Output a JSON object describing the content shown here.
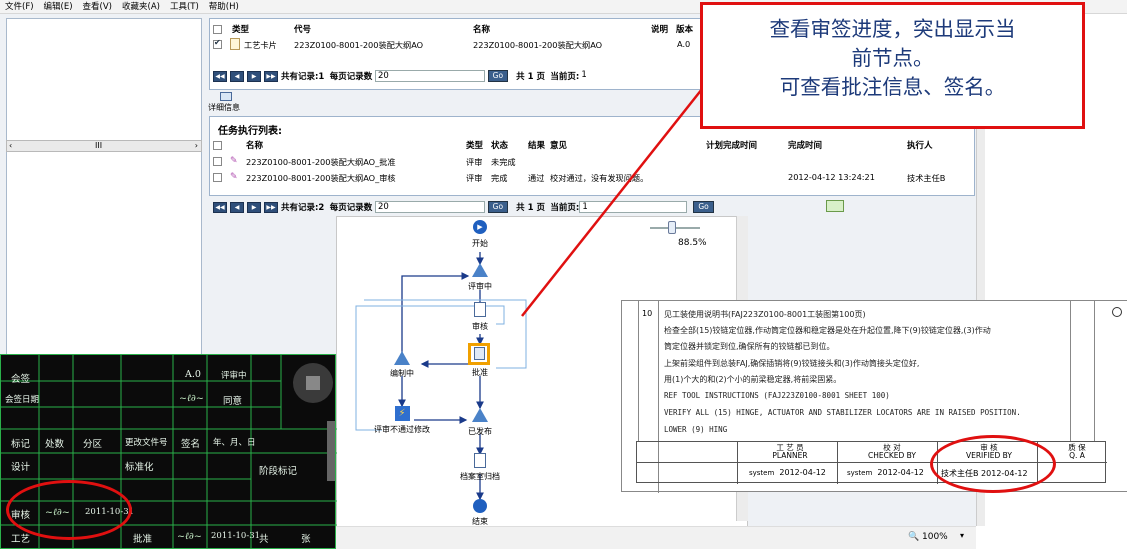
{
  "menu": [
    "文件(F)",
    "编辑(E)",
    "查看(V)",
    "收藏夹(A)",
    "工具(T)",
    "帮助(H)"
  ],
  "tree_scroll_thumb": "III",
  "top_table": {
    "headers": [
      "类型",
      "代号",
      "名称",
      "说明",
      "版本"
    ],
    "row": {
      "type": "工艺卡片",
      "code": "223Z0100-8001-200装配大纲AO",
      "name": "223Z0100-8001-200装配大纲AO",
      "version": "A.0"
    }
  },
  "pager1": {
    "total_label": "共有记录:1",
    "per_page_label": "每页记录数",
    "per_page": "20",
    "go": "Go",
    "pages": "共 1 页",
    "current_label": "当前页:",
    "current": "1"
  },
  "detail_label": "详细信息",
  "task_title": "任务执行列表:",
  "task_headers": {
    "name": "名称",
    "type": "类型",
    "status": "状态",
    "result": "结果",
    "opinion": "意见",
    "plan": "计划完成时间",
    "done": "完成时间",
    "executor": "执行人"
  },
  "tasks": [
    {
      "name": "223Z0100-8001-200装配大纲AO_批准",
      "type": "评审",
      "status": "未完成",
      "result": "",
      "opinion": "",
      "done": "",
      "executor": ""
    },
    {
      "name": "223Z0100-8001-200装配大纲AO_审核",
      "type": "评审",
      "status": "完成",
      "result": "通过",
      "opinion": "校对通过，没有发现问题。",
      "done": "2012-04-12 13:24:21",
      "executor": "技术主任B"
    }
  ],
  "pager2": {
    "total_label": "共有记录:2",
    "per_page_label": "每页记录数",
    "per_page": "20",
    "go": "Go",
    "pages": "共 1 页",
    "current_label": "当前页:",
    "current": "1"
  },
  "zoom_graph": "88.5%",
  "workflow": {
    "start": "开始",
    "review": "评审中",
    "audit": "审核",
    "approve": "批准",
    "edit": "编制中",
    "reject": "评审不通过修改",
    "published": "已发布",
    "archive": "档案室归档",
    "end": "结束"
  },
  "callout": [
    "查看审签进度，突出显示当",
    "前节点。",
    "可查看批注信息、签名。"
  ],
  "doc": {
    "row_num": "10",
    "lines": [
      "见工装使用说明书(FAJ223Z0100-8001工装图第100页)",
      "检查全部(15)铰链定位器,作动筒定位器和稳定器是处在升起位置,降下(9)铰链定位器,(3)作动",
      "筒定位器并锁定到位,确保所有的铰链都已到位。",
      "上架前梁组件到总装FAJ,确保插销将(9)铰链接头和(3)作动筒接头定位好,",
      "用(1)个大的和(2)个小的前梁稳定器,将前梁固紧。",
      "REF TOOL INSTRUCTIONS (FAJ223Z0100-8001 SHEET 100)",
      "VERIFY ALL (15) HINGE, ACTUATOR AND STABILIZER LOCATORS ARE IN RAISED POSITION.",
      "LOWER (9) HING"
    ],
    "sig_headers": [
      {
        "cn": "工 艺 员",
        "en": "PLANNER"
      },
      {
        "cn": "校 对",
        "en": "CHECKED BY"
      },
      {
        "cn": "审 核",
        "en": "VERIFIED BY"
      },
      {
        "cn": "质 保",
        "en": "Q. A"
      }
    ],
    "sig_values": [
      {
        "name": "system",
        "date": "2012-04-12"
      },
      {
        "name": "system",
        "date": "2012-04-12"
      },
      {
        "name": "技术主任B",
        "date": "2012-04-12"
      }
    ]
  },
  "overlay": {
    "labels": {
      "huiqian": "会签",
      "date": "会签日期",
      "mark": "标记",
      "count": "处数",
      "zone": "分区",
      "file": "更改文件号",
      "sign": "签名",
      "ymd": "年、月、日",
      "design": "设计",
      "std": "标准化",
      "stage": "阶段标记",
      "verify": "审核",
      "process": "工艺",
      "approve": "批准",
      "total": "共",
      "sheet": "张"
    },
    "version": "A.0",
    "state": "评审中",
    "tongyi": "同意",
    "verify_date": "2011-10-31",
    "approve_date": "2011-10-31"
  },
  "status_zoom": "100%"
}
